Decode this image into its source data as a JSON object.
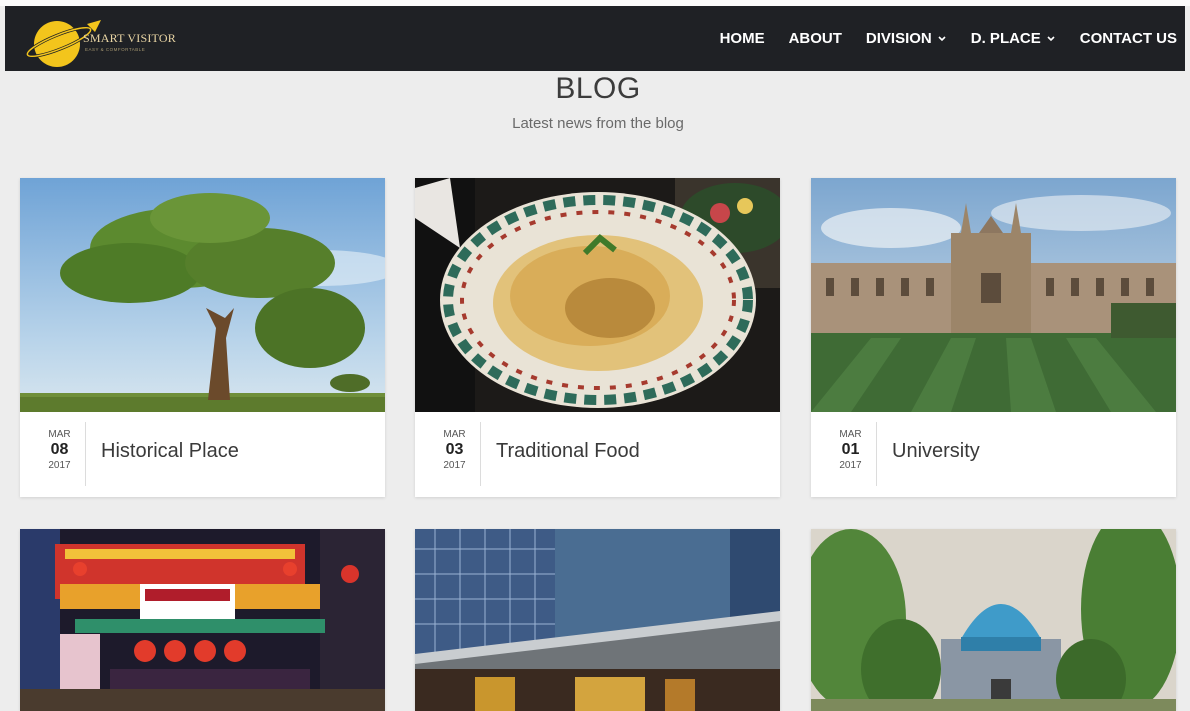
{
  "nav": {
    "logo_title": "SMART VISITOR",
    "logo_sub": "EASY & COMFORTABLE",
    "items": [
      {
        "label": "HOME",
        "dropdown": false
      },
      {
        "label": "ABOUT",
        "dropdown": false
      },
      {
        "label": "DIVISION",
        "dropdown": true
      },
      {
        "label": "D. PLACE",
        "dropdown": true
      },
      {
        "label": "CONTACT US",
        "dropdown": false
      }
    ]
  },
  "header": {
    "title": "BLOG",
    "subtitle": "Latest news from the blog"
  },
  "posts": [
    {
      "month": "MAR",
      "day": "08",
      "year": "2017",
      "title": "Historical Place",
      "image": "tree-photo"
    },
    {
      "month": "MAR",
      "day": "03",
      "year": "2017",
      "title": "Traditional Food",
      "image": "food-plate-photo"
    },
    {
      "month": "MAR",
      "day": "01",
      "year": "2017",
      "title": "University",
      "image": "university-building-photo"
    },
    {
      "image": "night-market-photo"
    },
    {
      "image": "clinic-building-photo"
    },
    {
      "image": "mosque-photo"
    }
  ],
  "colors": {
    "navbar": "#1f2125",
    "page_bg": "#ededed",
    "logo_accent": "#f3c51c"
  }
}
